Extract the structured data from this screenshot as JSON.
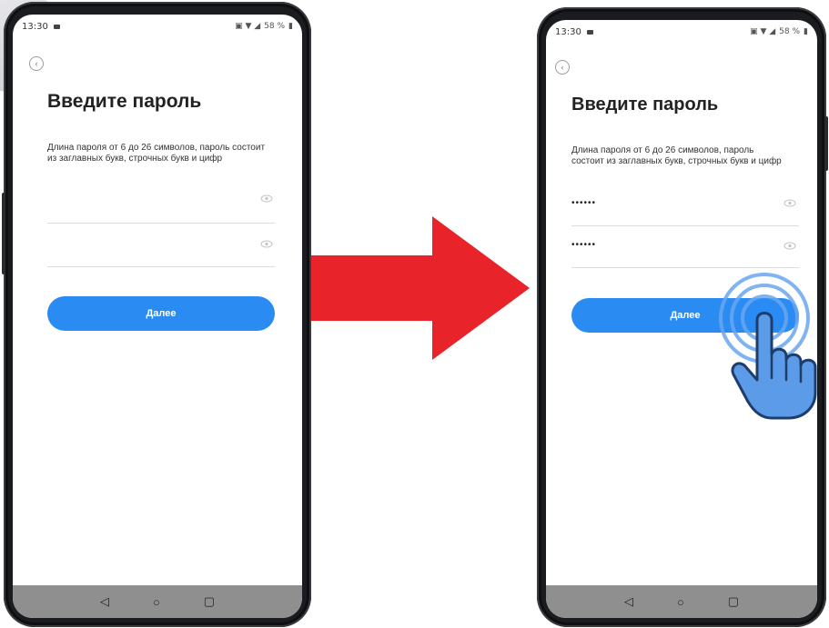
{
  "status": {
    "time": "13:30",
    "battery": "58 %"
  },
  "screen": {
    "title": "Введите пароль",
    "description": "Длина пароля от 6 до 26 символов, пароль состоит из заглавных букв, строчных букв и цифр",
    "next_label": "Далее"
  },
  "left_phone": {
    "password": "",
    "confirm_password": ""
  },
  "right_phone": {
    "password": "••••••",
    "confirm_password": "••••••"
  },
  "colors": {
    "accent": "#2a8cf3",
    "arrow": "#e8232a",
    "hand": "#5b9be8"
  },
  "icons": [
    "back-arrow-icon",
    "eye-icon",
    "nav-back-icon",
    "nav-home-icon",
    "nav-recents-icon",
    "red-arrow-icon",
    "tap-hand-icon"
  ]
}
